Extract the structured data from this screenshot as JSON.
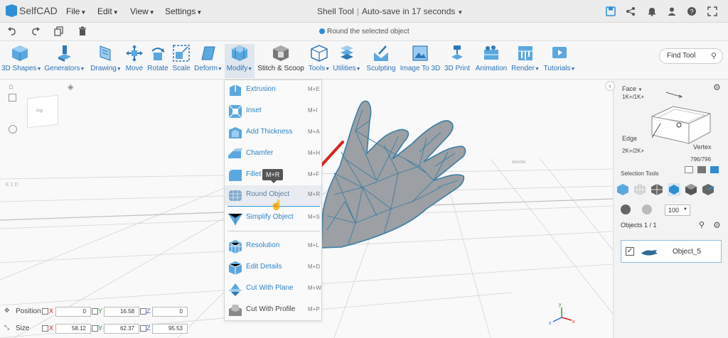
{
  "app": {
    "name": "SelfCAD"
  },
  "menus": [
    {
      "label": "File"
    },
    {
      "label": "Edit"
    },
    {
      "label": "View"
    },
    {
      "label": "Settings"
    }
  ],
  "title": {
    "tool": "Shell Tool",
    "autosave": "Auto-save in 17 seconds"
  },
  "hint": "Round the selected object",
  "ribbon": [
    {
      "label": "3D Shapes",
      "caret": true
    },
    {
      "label": "Generators",
      "caret": true
    },
    {
      "label": "Drawing",
      "caret": true
    },
    {
      "label": "Move",
      "caret": false
    },
    {
      "label": "Rotate",
      "caret": false
    },
    {
      "label": "Scale",
      "caret": false
    },
    {
      "label": "Deform",
      "caret": true
    },
    {
      "label": "Modify",
      "caret": true
    },
    {
      "label": "Stitch & Scoop",
      "caret": false
    },
    {
      "label": "Tools",
      "caret": true
    },
    {
      "label": "Utilities",
      "caret": true
    },
    {
      "label": "Sculpting",
      "caret": false
    },
    {
      "label": "Image To 3D",
      "caret": false
    },
    {
      "label": "3D Print",
      "caret": false
    },
    {
      "label": "Animation",
      "caret": false
    },
    {
      "label": "Render",
      "caret": true
    },
    {
      "label": "Tutorials",
      "caret": true
    }
  ],
  "find_tool": "Find Tool",
  "modify_menu": {
    "items": [
      {
        "label": "Extrusion",
        "key": "M+E"
      },
      {
        "label": "Inset",
        "key": "M+I"
      },
      {
        "label": "Add Thickness",
        "key": "M+A"
      },
      {
        "label": "Chamfer",
        "key": "M+H"
      },
      {
        "label": "Fillet",
        "key": "M+F"
      },
      {
        "label": "Round Object",
        "key": "M+R"
      },
      {
        "label": "Simplify Object",
        "key": "M+S"
      },
      {
        "label": "Resolution",
        "key": "M+L"
      },
      {
        "label": "Edit Details",
        "key": "M+D"
      },
      {
        "label": "Cut With Plane",
        "key": "M+W"
      },
      {
        "label": "Cut With Profile",
        "key": "M+P"
      }
    ],
    "tooltip": "M+R"
  },
  "viewcube_face": "Rig",
  "right_panel": {
    "face_label": "Face",
    "face_count": "1K+/1K+",
    "edge_label": "Edge",
    "edge_count": "2K+/2K+",
    "vertex_label": "Vertex",
    "vertex_count": "796/796",
    "selection_tools": "Selection Tools",
    "brush_size": "100",
    "objects_label": "Objects 1 / 1",
    "object_name": "Object_5"
  },
  "transform": {
    "position_label": "Position",
    "size_label": "Size",
    "position": {
      "x": "0",
      "y": "16.58",
      "z": "0"
    },
    "size": {
      "x": "58.12",
      "y": "62.37",
      "z": "95.53"
    },
    "axis_x": "X",
    "axis_y": "Y",
    "axis_z": "Z"
  },
  "colors": {
    "accent": "#2d8ed6",
    "mesh_fill": "#9c9fa3",
    "mesh_wire": "#3a7fa6",
    "arrow": "#e02020"
  }
}
